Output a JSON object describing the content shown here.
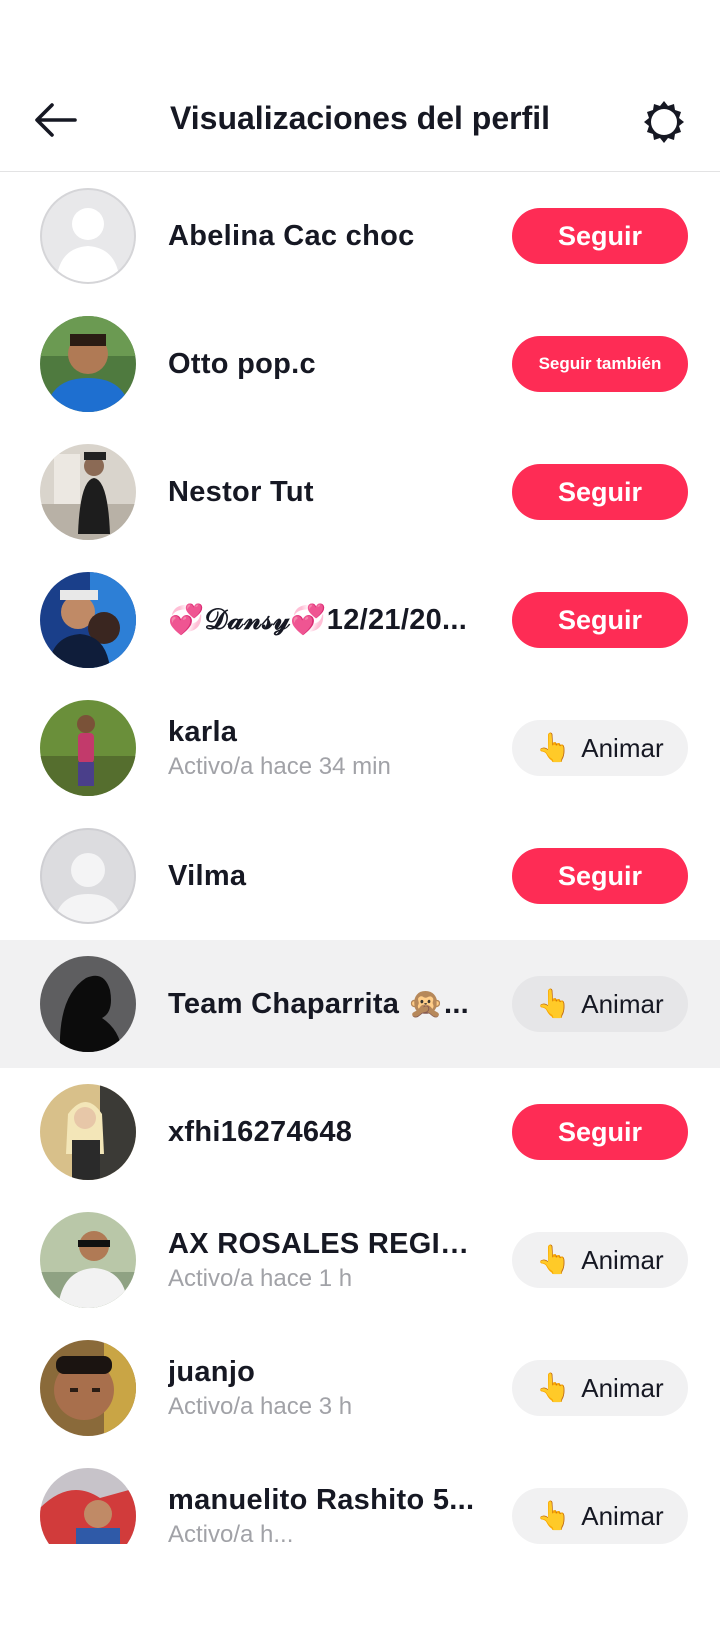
{
  "header": {
    "title": "Visualizaciones del perfil",
    "back_icon": "arrow-left-icon",
    "settings_icon": "gear-icon"
  },
  "colors": {
    "follow_button": "#fe2c55",
    "wave_button": "#f1f1f2",
    "highlight_row": "#f1f1f2",
    "secondary_text": "#a1a2a7"
  },
  "viewers": [
    {
      "name": "Abelina Cac choc",
      "status": "",
      "action": "Seguir",
      "action_type": "follow",
      "wave_emoji": ""
    },
    {
      "name": "Otto pop.c",
      "status": "",
      "action": "Seguir también",
      "action_type": "follow-small",
      "wave_emoji": ""
    },
    {
      "name": "Nestor Tut",
      "status": "",
      "action": "Seguir",
      "action_type": "follow",
      "wave_emoji": ""
    },
    {
      "name": "💞𝒟𝒶𝓃𝓈𝓎💞12/21/20...",
      "status": "",
      "action": "Seguir",
      "action_type": "follow",
      "wave_emoji": ""
    },
    {
      "name": "karla",
      "status": "Activo/a hace 34 min",
      "action": "Animar",
      "action_type": "wave",
      "wave_emoji": "👆"
    },
    {
      "name": "Vilma",
      "status": "",
      "action": "Seguir",
      "action_type": "follow",
      "wave_emoji": ""
    },
    {
      "name": "Team Chaparrita 🙊...",
      "status": "",
      "action": "Animar",
      "action_type": "wave",
      "wave_emoji": "👆"
    },
    {
      "name": "xfhi16274648",
      "status": "",
      "action": "Seguir",
      "action_type": "follow",
      "wave_emoji": ""
    },
    {
      "name": "AX ROSALES REGIL...",
      "status": "Activo/a hace 1 h",
      "action": "Animar",
      "action_type": "wave",
      "wave_emoji": "👆"
    },
    {
      "name": "juanjo",
      "status": "Activo/a hace 3 h",
      "action": "Animar",
      "action_type": "wave",
      "wave_emoji": "👆"
    },
    {
      "name": "manuelito Rashito 5...",
      "status": "Activo/a h...",
      "action": "Animar",
      "action_type": "wave",
      "wave_emoji": "👆"
    }
  ]
}
